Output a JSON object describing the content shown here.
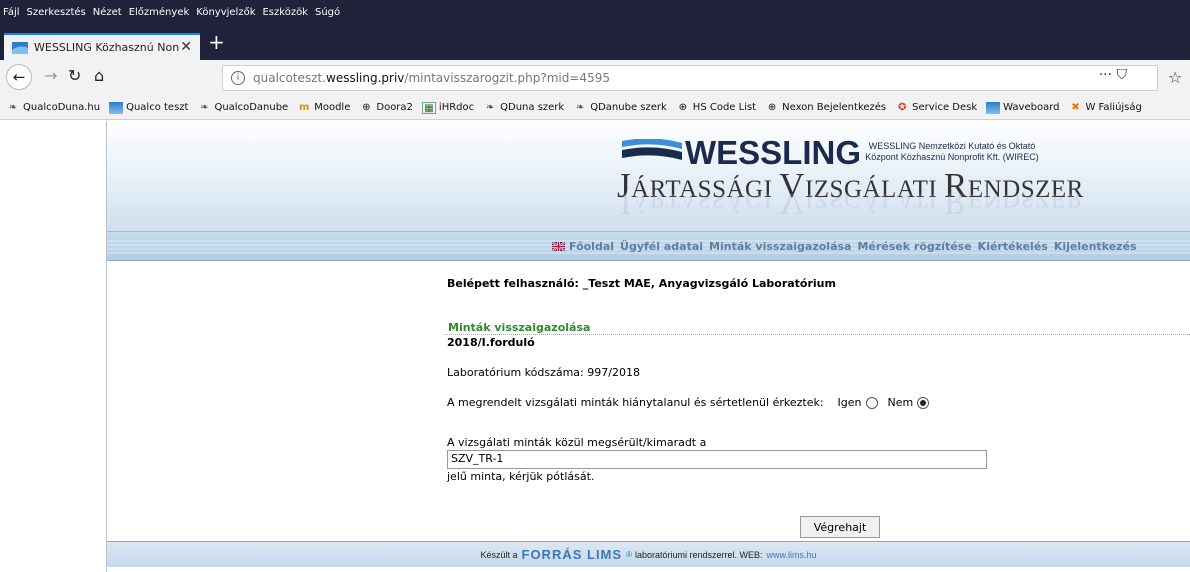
{
  "menu": [
    "Fájl",
    "Szerkesztés",
    "Nézet",
    "Előzmények",
    "Könyvjelzők",
    "Eszközök",
    "Súgó"
  ],
  "tab": {
    "title": "WESSLING Közhasznú Nonprofi"
  },
  "address": {
    "prefix": "qualcoteszt.",
    "domain": "wessling.priv",
    "path": "/mintavisszarogzit.php?mid=4595"
  },
  "bookmarks": [
    {
      "label": "QualcoDuna.hu",
      "icon": "dragon-icon"
    },
    {
      "label": "Qualco teszt",
      "icon": "wessling-icon"
    },
    {
      "label": "QualcoDanube",
      "icon": "dragon-icon"
    },
    {
      "label": "Moodle",
      "icon": "moodle-icon"
    },
    {
      "label": "Doora2",
      "icon": "globe-icon"
    },
    {
      "label": "iHRdoc",
      "icon": "ihrdoc-icon"
    },
    {
      "label": "QDuna szerk",
      "icon": "dragon-icon"
    },
    {
      "label": "QDanube szerk",
      "icon": "dragon-icon"
    },
    {
      "label": "HS Code List",
      "icon": "globe-icon"
    },
    {
      "label": "Nexon Bejelentkezés",
      "icon": "globe-icon"
    },
    {
      "label": "Service Desk",
      "icon": "service-icon"
    },
    {
      "label": "Waveboard",
      "icon": "wessling-icon"
    },
    {
      "label": "W Faliújság",
      "icon": "pin-icon"
    }
  ],
  "header": {
    "brand": "WESSLING",
    "brand_sub_1": "WESSLING Nemzetközi Kutató és Oktató",
    "brand_sub_2": "Központ Közhasznú Nonprofit Kft. (WIREC)",
    "title_parts": [
      "J",
      "ÁRTASSÁGI ",
      "V",
      "IZSGÁLATI ",
      "R",
      "ENDSZER"
    ]
  },
  "nav": {
    "links": [
      "Főoldal",
      "Ügyfél adatai",
      "Minták visszaigazolása",
      "Mérések rögzítése",
      "Kiértékelés",
      "Kijelentkezés"
    ]
  },
  "content": {
    "user_line": "Belépett felhasználó: _Teszt MAE, Anyagvizsgáló Laboratórium",
    "section_title": "Minták visszaigazolása",
    "round": "2018/I.forduló",
    "lab_code": "Laboratórium kódszáma: 997/2018",
    "question": "A megrendelt vizsgálati minták hiánytalanul és sértetlenül érkeztek:",
    "yes_label": "Igen",
    "no_label": "Nem",
    "selected": "Nem",
    "damaged_label": "A vizsgálati minták közül megsérült/kimaradt a",
    "damaged_value": "SZV_TR-1",
    "after_label": "jelű minta, kérjük pótlását.",
    "submit_label": "Végrehajt"
  },
  "footer": {
    "prefix": "Készült a",
    "brand": "FORRÁS LIMS",
    "reg": "®",
    "suffix": "laboratóriumi rendszerrel.  WEB:",
    "web": "www.lims.hu"
  },
  "colors": {
    "chrome_dark": "#20223a",
    "accent_blue": "#0a84ff",
    "nav_link": "#5b7fa3",
    "section_green": "#2f8c2f",
    "lims_blue": "#3d78b8"
  }
}
